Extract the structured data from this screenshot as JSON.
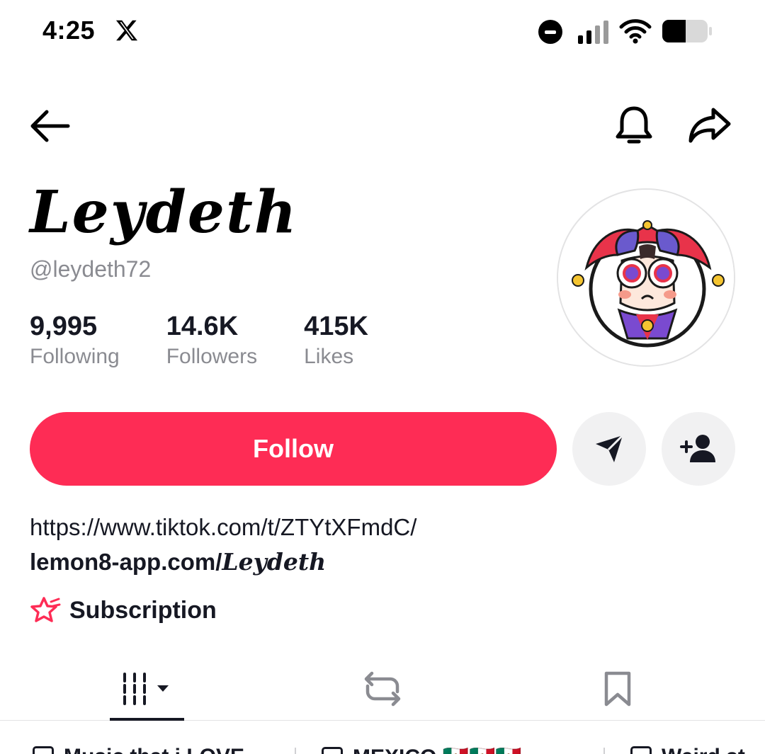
{
  "status_bar": {
    "time": "4:25",
    "app_icon": "x-logo-icon",
    "icons": [
      "do-not-disturb-icon",
      "signal-icon",
      "wifi-icon",
      "battery-icon"
    ]
  },
  "nav": {
    "back_icon": "back-arrow-icon",
    "bell_icon": "bell-icon",
    "share_icon": "share-icon"
  },
  "profile": {
    "display_name": "Leydeth",
    "username": "@leydeth72",
    "avatar": "pomni-jester-avatar",
    "stats": [
      {
        "value": "9,995",
        "label": "Following"
      },
      {
        "value": "14.6K",
        "label": "Followers"
      },
      {
        "value": "415K",
        "label": "Likes"
      }
    ]
  },
  "actions": {
    "follow_label": "Follow",
    "message_icon": "send-icon",
    "add_friend_icon": "add-user-icon"
  },
  "bio": {
    "link_1": "https://www.tiktok.com/t/ZTYtXFmdC/",
    "link_2_prefix": "lemon8-app.com/",
    "link_2_script": "Leydeth"
  },
  "subscription": {
    "icon": "subscription-star-icon",
    "label": "Subscription"
  },
  "tabs": [
    {
      "name": "videos",
      "icon": "grid-filter-icon",
      "active": true
    },
    {
      "name": "reposts",
      "icon": "repost-icon",
      "active": false
    },
    {
      "name": "saved",
      "icon": "bookmark-icon",
      "active": false
    }
  ],
  "playlists": [
    {
      "label": "Music that i LOVE"
    },
    {
      "label": "MEXICO 🇲🇽🇲🇽🇲🇽"
    },
    {
      "label": "Weird st"
    }
  ],
  "colors": {
    "accent": "#fe2c55",
    "text": "#161823",
    "muted": "#8a8b91",
    "button_gray": "#f1f1f2"
  }
}
